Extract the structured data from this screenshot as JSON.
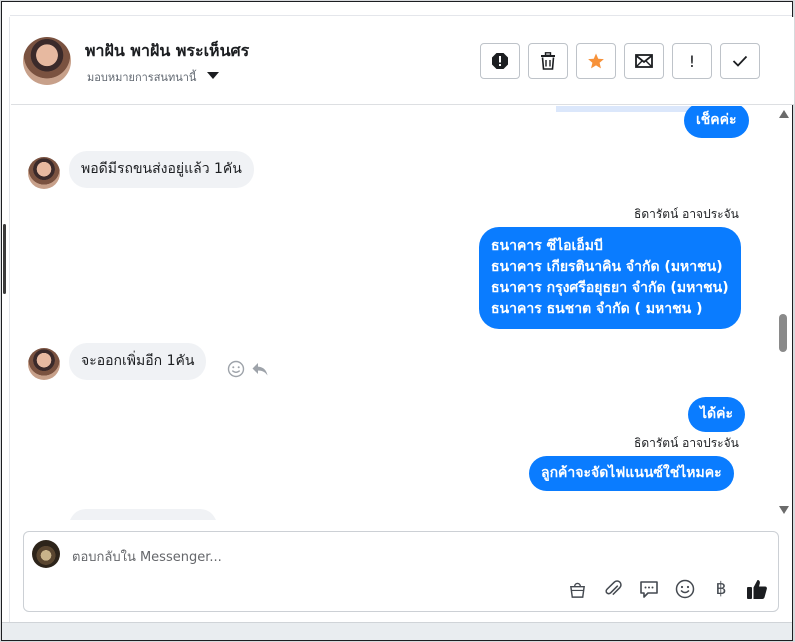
{
  "header": {
    "contact_name": "พาฝัน พาฝัน พระเห็นศร",
    "assign_label": "มอบหมายการสนทนานี้"
  },
  "toolbar": {
    "buttons": [
      "report-icon",
      "trash-icon",
      "star-icon",
      "mail-icon",
      "exclamation-icon",
      "check-icon"
    ],
    "exclamation_label": "!"
  },
  "messages": [
    {
      "direction": "out",
      "text": "เช็คค่ะ"
    },
    {
      "direction": "in",
      "text": "พอดีมีรถขนส่งอยู่แล้ว 1คัน"
    },
    {
      "direction": "out",
      "sender": "ธิดารัตน์ อาจประจัน",
      "lines": [
        "ธนาคาร ซีไอเอ็มบี",
        "ธนาคาร เกียรตินาคิน จำกัด (มหาชน)",
        "ธนาคาร กรุงศรีอยุธยา จำกัด (มหาชน)",
        "ธนาคาร ธนชาต จำกัด ( มหาชน )"
      ]
    },
    {
      "direction": "in",
      "text": "จะออกเพิ่มอีก 1คัน"
    },
    {
      "direction": "out",
      "text": "ได้ค่ะ"
    },
    {
      "direction": "out",
      "sender": "ธิดารัตน์ อาจประจัน",
      "text": "ลูกค้าจะจัดไฟแนนซ์ใช่ไหมคะ"
    }
  ],
  "composer": {
    "placeholder": "ตอบกลับใน Messenger...",
    "tools": [
      "bag-icon",
      "paperclip-icon",
      "chat-bubble-icon",
      "emoji-icon",
      "baht-icon",
      "thumbs-up-icon"
    ],
    "baht_symbol": "฿"
  },
  "colors": {
    "accent": "#0a7cff",
    "incoming_bubble": "#f0f2f5",
    "star": "#f7923a"
  }
}
